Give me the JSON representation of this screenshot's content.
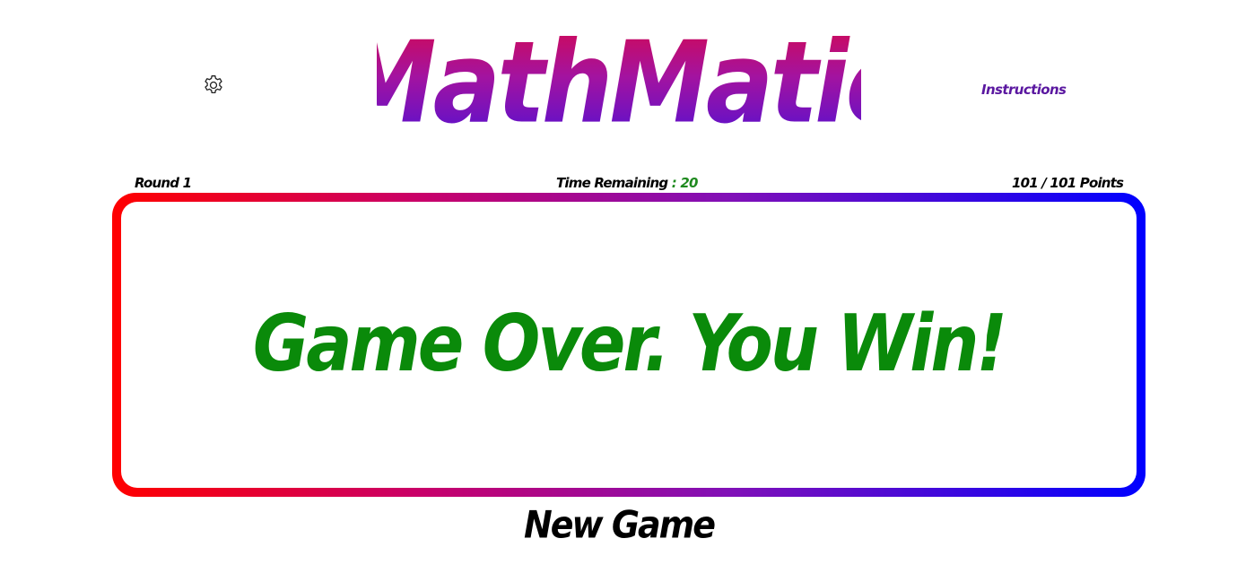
{
  "header": {
    "settings_icon": "gear-icon",
    "logo_text": "MathMatic",
    "logo_colors": [
      "#d8084a",
      "#a313a0",
      "#4a10d8"
    ],
    "instructions_label": "Instructions"
  },
  "status": {
    "round_label": "Round 1",
    "time_remaining_label": "Time Remaining",
    "time_separator": " : ",
    "time_remaining_value": "20",
    "points_label": "101 / 101 Points"
  },
  "board": {
    "message": "Game Over. You Win!",
    "message_color": "#0a8a0a",
    "border_colors": [
      "#ff0000",
      "#0000ff"
    ]
  },
  "actions": {
    "new_game_label": "New Game"
  }
}
